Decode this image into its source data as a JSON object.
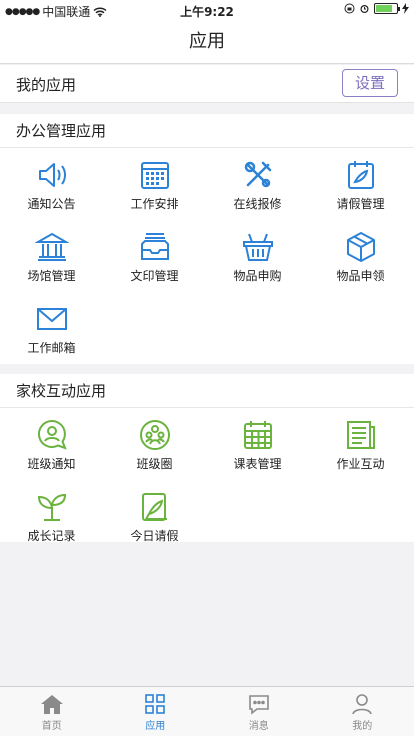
{
  "status_bar": {
    "carrier": "中国联通",
    "time": "上午9:22"
  },
  "nav": {
    "title": "应用"
  },
  "my_apps": {
    "title": "我的应用",
    "settings_label": "设置"
  },
  "office": {
    "title": "办公管理应用",
    "accent": "#2c82d6",
    "items": [
      {
        "label": "通知公告",
        "icon": "speaker-icon"
      },
      {
        "label": "工作安排",
        "icon": "calendar-icon"
      },
      {
        "label": "在线报修",
        "icon": "repair-tools-icon"
      },
      {
        "label": "请假管理",
        "icon": "leave-note-icon"
      },
      {
        "label": "场馆管理",
        "icon": "building-icon"
      },
      {
        "label": "文印管理",
        "icon": "print-tray-icon"
      },
      {
        "label": "物品申购",
        "icon": "basket-icon"
      },
      {
        "label": "物品申领",
        "icon": "box-icon"
      },
      {
        "label": "工作邮箱",
        "icon": "mail-icon"
      }
    ]
  },
  "home_school": {
    "title": "家校互动应用",
    "accent": "#6ab33e",
    "items": [
      {
        "label": "班级通知",
        "icon": "class-notice-icon"
      },
      {
        "label": "班级圈",
        "icon": "class-circle-icon"
      },
      {
        "label": "课表管理",
        "icon": "timetable-icon"
      },
      {
        "label": "作业互动",
        "icon": "homework-icon"
      },
      {
        "label": "成长记录",
        "icon": "sprout-icon"
      },
      {
        "label": "今日请假",
        "icon": "today-leave-icon"
      }
    ]
  },
  "tabs": [
    {
      "label": "首页",
      "icon": "home-icon"
    },
    {
      "label": "应用",
      "icon": "apps-icon",
      "active": true
    },
    {
      "label": "消息",
      "icon": "message-icon"
    },
    {
      "label": "我的",
      "icon": "profile-icon"
    }
  ]
}
